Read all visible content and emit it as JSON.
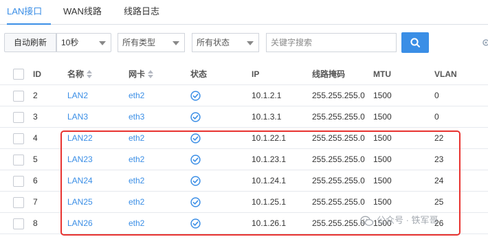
{
  "tabs": [
    {
      "label": "LAN接口",
      "active": true
    },
    {
      "label": "WAN线路",
      "active": false
    },
    {
      "label": "线路日志",
      "active": false
    }
  ],
  "toolbar": {
    "refresh_label": "自动刷新",
    "interval_value": "10秒",
    "type_filter": "所有类型",
    "status_filter": "所有状态",
    "search_placeholder": "关键字搜索"
  },
  "table": {
    "headers": {
      "id": "ID",
      "name": "名称",
      "nic": "网卡",
      "status": "状态",
      "ip": "IP",
      "mask": "线路掩码",
      "mtu": "MTU",
      "vlan": "VLAN"
    },
    "rows": [
      {
        "id": "2",
        "name": "LAN2",
        "nic": "eth2",
        "status": "ok",
        "ip": "10.1.2.1",
        "mask": "255.255.255.0",
        "mtu": "1500",
        "vlan": "0"
      },
      {
        "id": "3",
        "name": "LAN3",
        "nic": "eth3",
        "status": "ok",
        "ip": "10.1.3.1",
        "mask": "255.255.255.0",
        "mtu": "1500",
        "vlan": "0"
      },
      {
        "id": "4",
        "name": "LAN22",
        "nic": "eth2",
        "status": "ok",
        "ip": "10.1.22.1",
        "mask": "255.255.255.0",
        "mtu": "1500",
        "vlan": "22"
      },
      {
        "id": "5",
        "name": "LAN23",
        "nic": "eth2",
        "status": "ok",
        "ip": "10.1.23.1",
        "mask": "255.255.255.0",
        "mtu": "1500",
        "vlan": "23"
      },
      {
        "id": "6",
        "name": "LAN24",
        "nic": "eth2",
        "status": "ok",
        "ip": "10.1.24.1",
        "mask": "255.255.255.0",
        "mtu": "1500",
        "vlan": "24"
      },
      {
        "id": "7",
        "name": "LAN25",
        "nic": "eth2",
        "status": "ok",
        "ip": "10.1.25.1",
        "mask": "255.255.255.0",
        "mtu": "1500",
        "vlan": "25"
      },
      {
        "id": "8",
        "name": "LAN26",
        "nic": "eth2",
        "status": "ok",
        "ip": "10.1.26.1",
        "mask": "255.255.255.0",
        "mtu": "1500",
        "vlan": "26"
      }
    ]
  },
  "watermark": {
    "text": "公众号 · 铁军哥",
    "icon": "wechat-icon"
  },
  "colors": {
    "accent": "#3a8ee6",
    "highlight": "#e8322f",
    "ok": "#3a8ee6"
  }
}
